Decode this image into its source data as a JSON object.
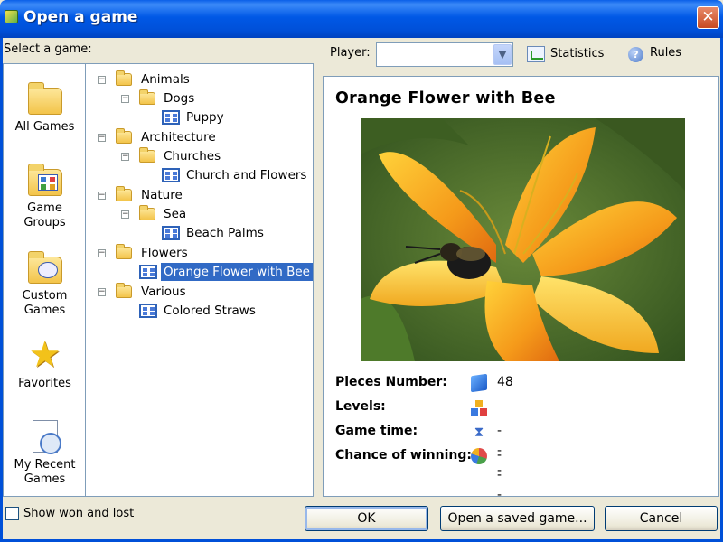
{
  "window": {
    "title": "Open a game",
    "close_label": "✕"
  },
  "select_label": "Select a game:",
  "sidebar": [
    {
      "label": "All Games",
      "icon": "folder-icon"
    },
    {
      "label": "Game Groups",
      "icon": "game-groups-icon"
    },
    {
      "label": "Custom Games",
      "icon": "custom-games-icon"
    },
    {
      "label": "Favorites",
      "icon": "star-icon"
    },
    {
      "label": "My Recent Games",
      "icon": "recent-games-icon"
    }
  ],
  "tree": {
    "animals": "Animals",
    "dogs": "Dogs",
    "puppy": "Puppy",
    "architecture": "Architecture",
    "churches": "Churches",
    "church_flowers": "Church and Flowers",
    "nature": "Nature",
    "sea": "Sea",
    "beach_palms": "Beach Palms",
    "flowers": "Flowers",
    "orange_flower": "Orange Flower with Bee",
    "various": "Various",
    "colored_straws": "Colored Straws"
  },
  "toolbar": {
    "player_label": "Player:",
    "player_value": "",
    "statistics_label": "Statistics",
    "rules_label": "Rules"
  },
  "preview": {
    "title": "Orange Flower with Bee",
    "pieces_label": "Pieces Number:",
    "pieces_value": "48",
    "levels_label": "Levels:",
    "levels_value": "",
    "time_label": "Game time:",
    "time_value": "---",
    "chance_label": "Chance of winning:",
    "chance_value": "---"
  },
  "footer": {
    "show_won_lost": "Show won and lost",
    "ok": "OK",
    "open_saved": "Open a saved game...",
    "cancel": "Cancel"
  }
}
